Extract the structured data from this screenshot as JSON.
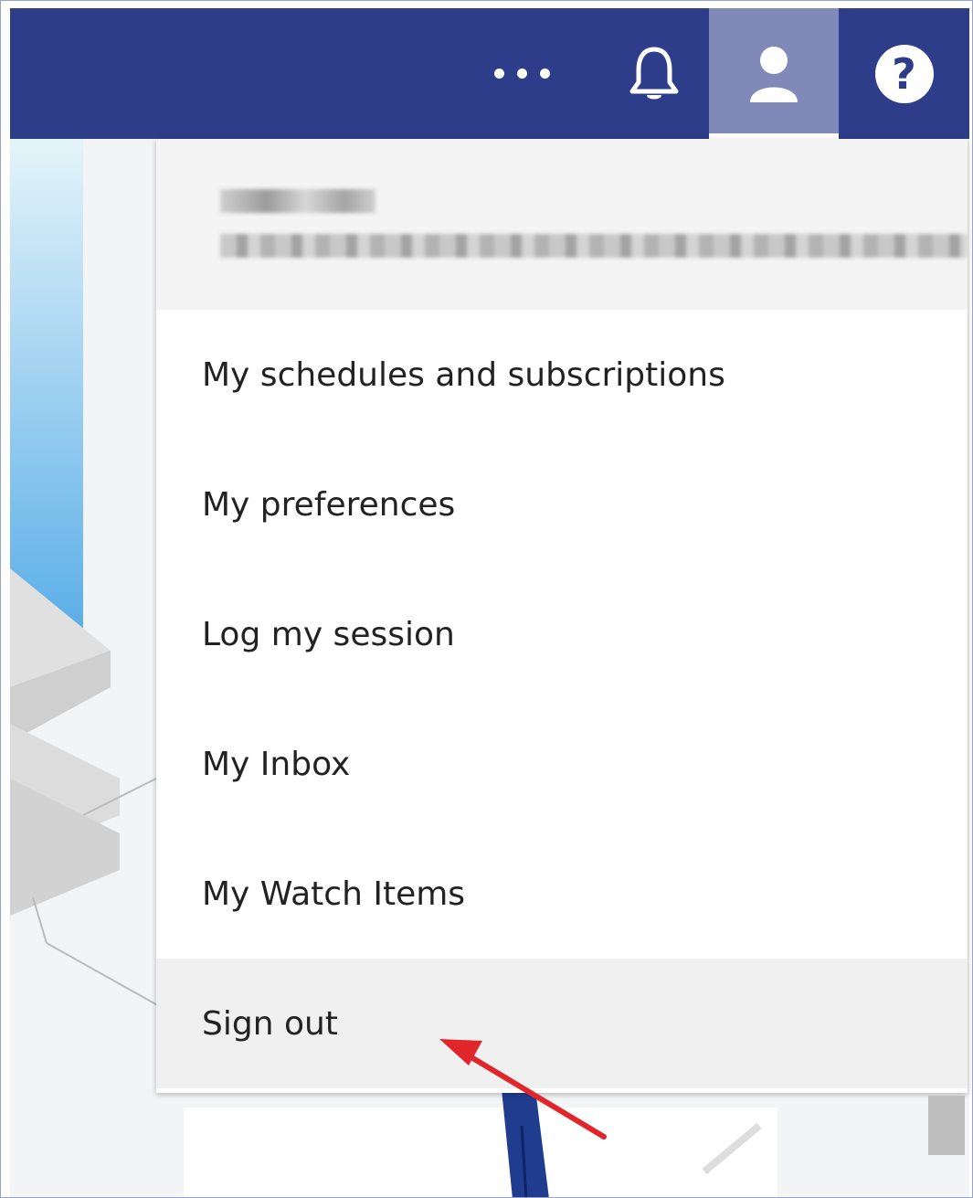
{
  "header": {
    "more_icon": "more-horizontal-icon",
    "notification_icon": "bell-icon",
    "user_icon": "user-icon",
    "help_label": "?"
  },
  "user_menu": {
    "username": "",
    "email": "",
    "items": [
      {
        "label": "My schedules and subscriptions"
      },
      {
        "label": "My preferences"
      },
      {
        "label": "Log my session"
      },
      {
        "label": "My Inbox"
      },
      {
        "label": "My Watch Items"
      },
      {
        "label": "Sign out"
      }
    ]
  },
  "colors": {
    "topbar": "#2e3d89",
    "user_active": "#8189b9",
    "annotation_arrow": "#e0262b"
  }
}
